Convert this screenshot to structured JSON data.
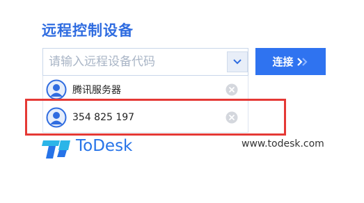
{
  "header": {
    "title": "远程控制设备"
  },
  "search": {
    "placeholder": "请输入远程设备代码",
    "value": "",
    "dropdown_icon": "chevron-down-icon"
  },
  "connect_button": {
    "label": "连接",
    "icon": "double-chevron-right-icon"
  },
  "recent_list": {
    "items": [
      {
        "label": "腾讯服务器",
        "icon": "user-avatar-icon",
        "remove_icon": "close-circle-icon"
      },
      {
        "label": "354 825 197",
        "icon": "user-avatar-icon",
        "remove_icon": "close-circle-icon"
      }
    ]
  },
  "brand": {
    "name": "ToDesk",
    "website": "www.todesk.com"
  },
  "colors": {
    "accent": "#2f6ce0",
    "button": "#2f73f0",
    "highlight_border": "#e53935",
    "brand_blue": "#2673e8",
    "brand_cyan": "#2bb5e8"
  }
}
